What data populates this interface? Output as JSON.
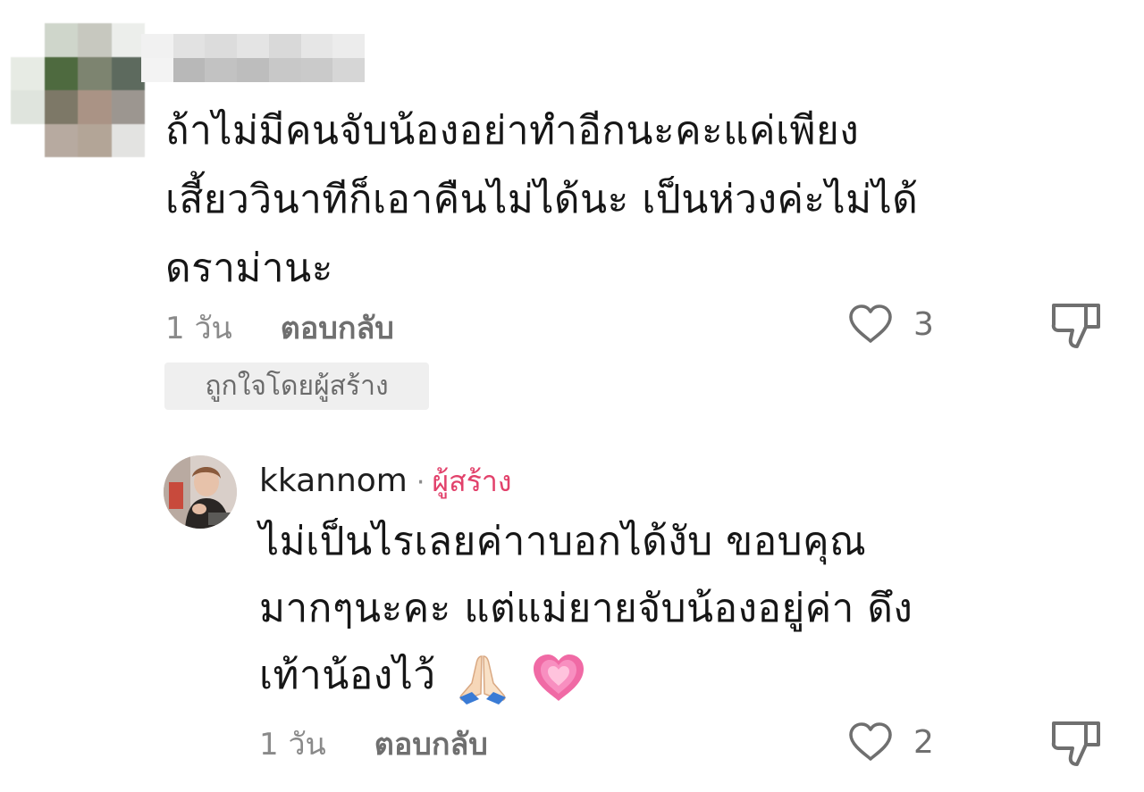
{
  "comment": {
    "lines": [
      "ถ้าไม่มีคนจับน้องอย่าทำอีกนะคะแค่เพียง",
      "เสี้ยววินาทีก็เอาคืนไม่ได้นะ เป็นห่วงค่ะไม่ได้",
      "ดราม่านะ"
    ],
    "time": "1 วัน",
    "reply_label": "ตอบกลับ",
    "like_count": "3",
    "creator_liked_label": "ถูกใจโดยผู้สร้าง"
  },
  "reply": {
    "username": "kkannom",
    "separator": "·",
    "creator_tag": "ผู้สร้าง",
    "lines": [
      "ไม่เป็นไรเลยค่าาบอกได้งับ ขอบคุณ",
      "มากๆนะคะ แต่แม่ยายจับน้องอยู่ค่า ดึง",
      "เท้าน้องไว้"
    ],
    "emojis": [
      "praying-hands",
      "growing-heart"
    ],
    "time": "1 วัน",
    "reply_label": "ตอบกลับ",
    "like_count": "2"
  },
  "colors": {
    "creator_accent": "#e2416b",
    "meta_gray": "#8a8a8a",
    "badge_bg": "#efefef"
  },
  "icons": {
    "like": "heart-outline-icon",
    "dislike": "thumbs-down-icon"
  }
}
